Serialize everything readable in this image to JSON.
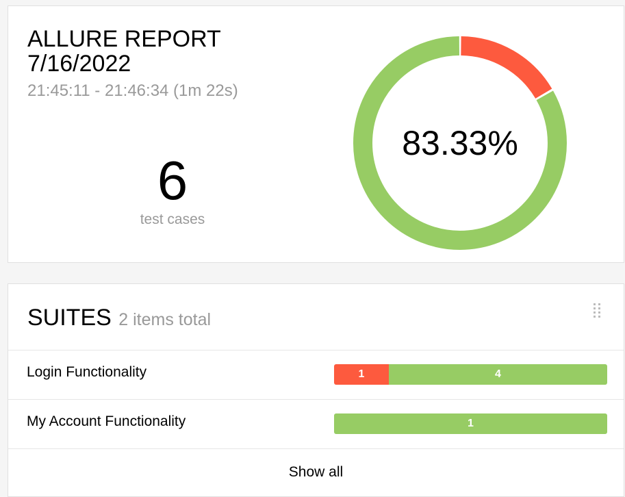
{
  "summary": {
    "title": "ALLURE REPORT 7/16/2022",
    "time_range": "21:45:11 - 21:46:34 (1m 22s)",
    "total_count": "6",
    "total_label": "test cases",
    "pass_rate_label": "83.33%",
    "pass_rate": 0.8333,
    "colors": {
      "failed": "#fd5a3e",
      "passed": "#97cc64"
    }
  },
  "suites": {
    "title": "SUITES",
    "count_text": "2 items total",
    "items": [
      {
        "name": "Login Functionality",
        "segments": [
          {
            "status": "failed",
            "count": 1,
            "label": "1",
            "color": "#fd5a3e"
          },
          {
            "status": "passed",
            "count": 4,
            "label": "4",
            "color": "#97cc64"
          }
        ]
      },
      {
        "name": "My Account Functionality",
        "segments": [
          {
            "status": "passed",
            "count": 1,
            "label": "1",
            "color": "#97cc64"
          }
        ]
      }
    ],
    "show_all_label": "Show all"
  }
}
